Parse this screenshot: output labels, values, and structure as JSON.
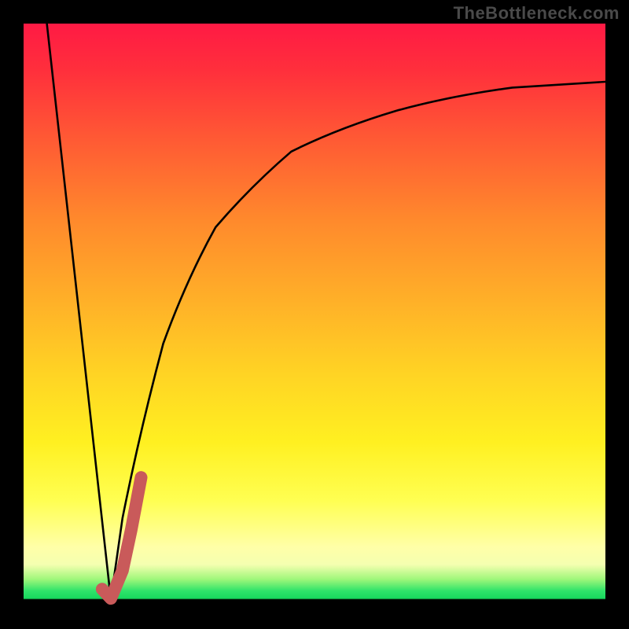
{
  "watermark": {
    "text": "TheBottleneck.com"
  },
  "colors": {
    "curve_black": "#000000",
    "marker_stroke": "#c95a5a",
    "gradient_top": "#ff1a44",
    "gradient_mid": "#ffd324",
    "gradient_bottom_green": "#18d85e"
  },
  "chart_data": {
    "type": "line",
    "title": "",
    "xlabel": "",
    "ylabel": "",
    "xlim": [
      0,
      100
    ],
    "ylim": [
      0,
      100
    ],
    "grid": false,
    "legend": false,
    "annotations": [],
    "series": [
      {
        "name": "left-descending-line",
        "x": [
          4,
          15
        ],
        "y": [
          100,
          1
        ]
      },
      {
        "name": "right-rising-curve",
        "x": [
          15,
          17,
          20,
          24,
          28,
          33,
          39,
          46,
          54,
          63,
          73,
          84,
          100
        ],
        "y": [
          1,
          15,
          30,
          45,
          56,
          65,
          72,
          78,
          82,
          85,
          87.5,
          89,
          90
        ]
      }
    ],
    "marker": {
      "name": "highlight-J-marker",
      "description": "Thick salmon J-shaped highlight near the vertex at x≈15–20, y≈1–22",
      "points_x": [
        13.5,
        15,
        17,
        18.5,
        20.2
      ],
      "points_y": [
        2.8,
        1.2,
        6,
        13,
        22
      ],
      "stroke_width_px": 16
    }
  }
}
